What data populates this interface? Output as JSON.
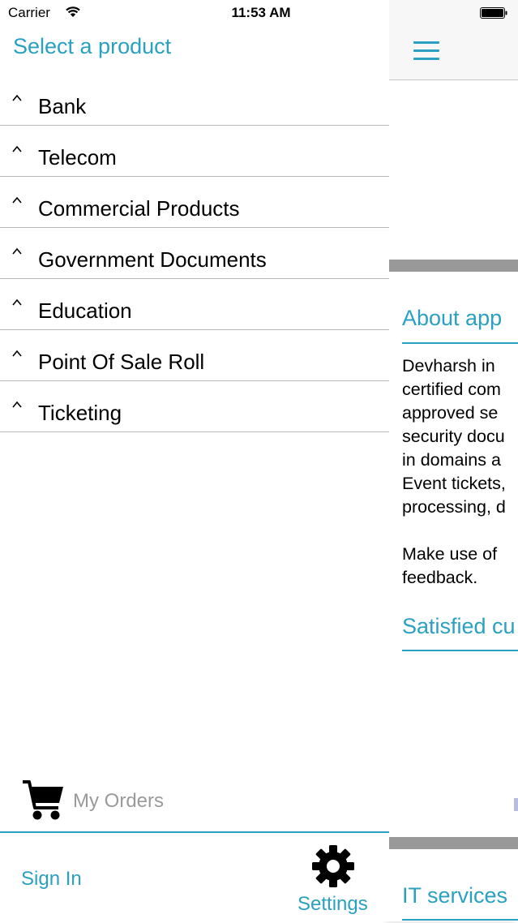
{
  "status_bar": {
    "carrier": "Carrier",
    "time": "11:53 AM"
  },
  "drawer": {
    "title": "Select a product",
    "products": [
      {
        "label": "Bank"
      },
      {
        "label": "Telecom"
      },
      {
        "label": "Commercial Products"
      },
      {
        "label": "Government Documents"
      },
      {
        "label": "Education"
      },
      {
        "label": "Point Of Sale Roll"
      },
      {
        "label": "Ticketing"
      }
    ],
    "my_orders": "My Orders",
    "sign_in": "Sign In",
    "settings": "Settings"
  },
  "main": {
    "about_title": "About app",
    "about_lines": [
      "Devharsh in",
      "certified com",
      "approved se",
      "security docu",
      "in domains a",
      "Event tickets,",
      "processing, d",
      "",
      "Make use of",
      "feedback."
    ],
    "satisfied_title": "Satisfied cu",
    "it_services_title": "IT services"
  },
  "colors": {
    "accent": "#2aa1c0",
    "divider": "#b9b9b9",
    "muted_text": "#9a9a9a",
    "gray_band": "#999999"
  },
  "icons": {
    "wifi": "wifi-icon",
    "battery": "battery-icon",
    "chevron": "chevron-up-icon",
    "cart": "shopping-cart-icon",
    "gear": "gear-icon",
    "menu": "hamburger-menu-icon"
  }
}
